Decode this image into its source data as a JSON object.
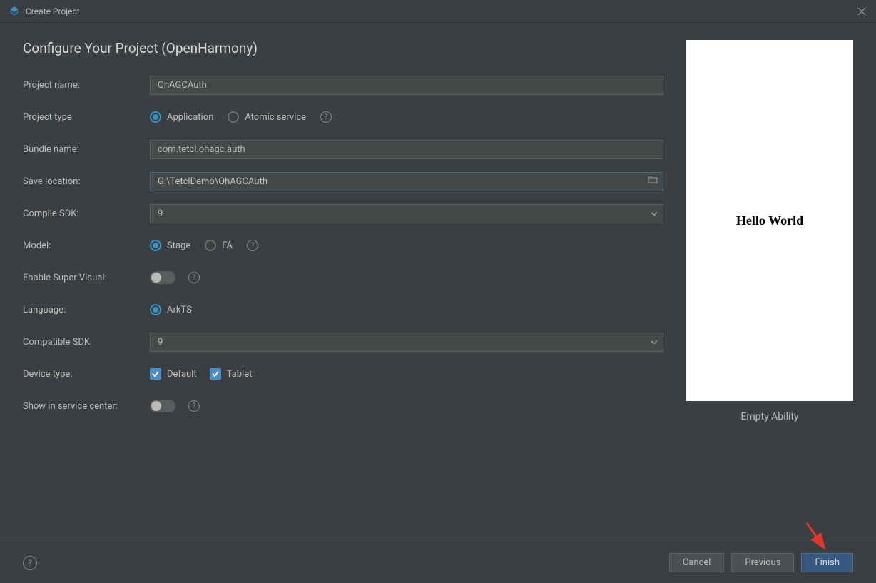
{
  "titlebar": {
    "title": "Create Project"
  },
  "heading": "Configure Your Project (OpenHarmony)",
  "fields": {
    "projectName": {
      "label": "Project name:",
      "value": "OhAGCAuth"
    },
    "projectType": {
      "label": "Project type:",
      "options": {
        "application": "Application",
        "atomic": "Atomic service"
      }
    },
    "bundleName": {
      "label": "Bundle name:",
      "value": "com.tetcl.ohagc.auth"
    },
    "saveLocation": {
      "label": "Save location:",
      "value": "G:\\TetclDemo\\OhAGCAuth"
    },
    "compileSdk": {
      "label": "Compile SDK:",
      "value": "9"
    },
    "model": {
      "label": "Model:",
      "options": {
        "stage": "Stage",
        "fa": "FA"
      }
    },
    "enableSuperVisual": {
      "label": "Enable Super Visual:"
    },
    "language": {
      "label": "Language:",
      "options": {
        "arkts": "ArkTS"
      }
    },
    "compatibleSdk": {
      "label": "Compatible SDK:",
      "value": "9"
    },
    "deviceType": {
      "label": "Device type:",
      "options": {
        "default": "Default",
        "tablet": "Tablet"
      }
    },
    "showInServiceCenter": {
      "label": "Show in service center:"
    }
  },
  "preview": {
    "content": "Hello World",
    "caption": "Empty Ability"
  },
  "footer": {
    "cancel": "Cancel",
    "previous": "Previous",
    "finish": "Finish"
  }
}
